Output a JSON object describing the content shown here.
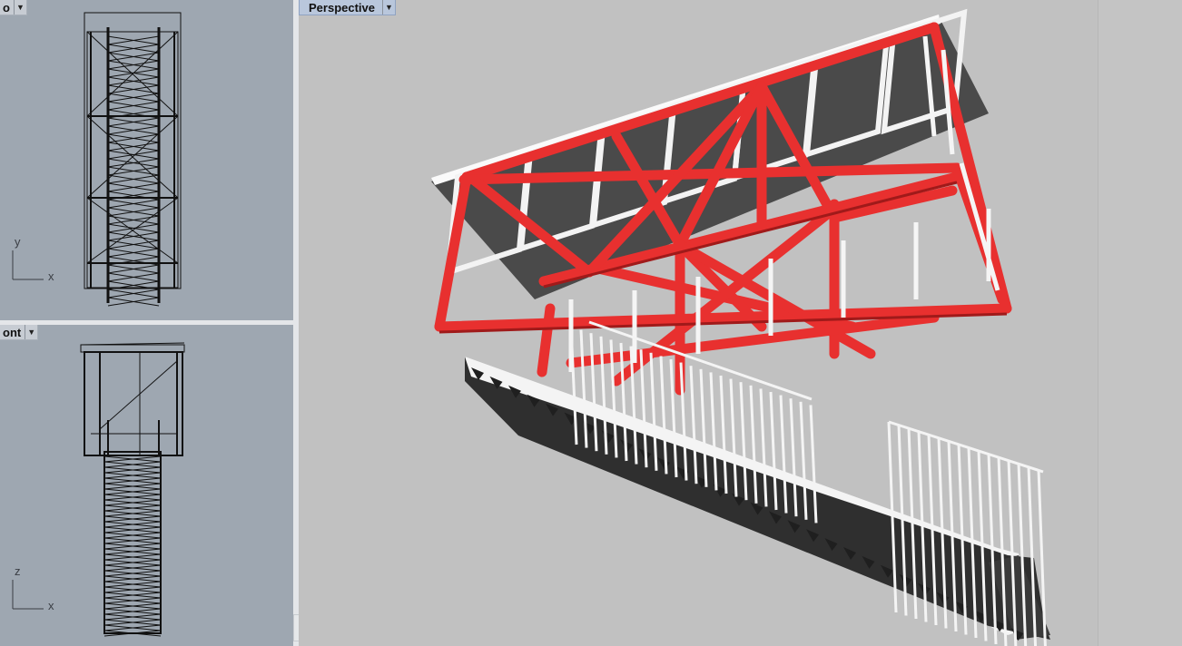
{
  "viewports": {
    "top": {
      "label": "o",
      "axis_h": "x",
      "axis_v": "y"
    },
    "front": {
      "label": "ont",
      "axis_h": "x",
      "axis_v": "z"
    },
    "perspective": {
      "label": "Perspective"
    }
  },
  "icons": {
    "dropdown": "triangle-down-icon"
  },
  "colors": {
    "steel": "#e8302f",
    "steel_shade": "#9b1a1a",
    "glass": "#4a4a4a",
    "railing": "#f2f2f2",
    "stair_top": "#f5f5f5",
    "stair_side": "#2e2e2e",
    "perspective_bg": "#c1c1c1",
    "ortho_bg": "#9ea7b1"
  }
}
